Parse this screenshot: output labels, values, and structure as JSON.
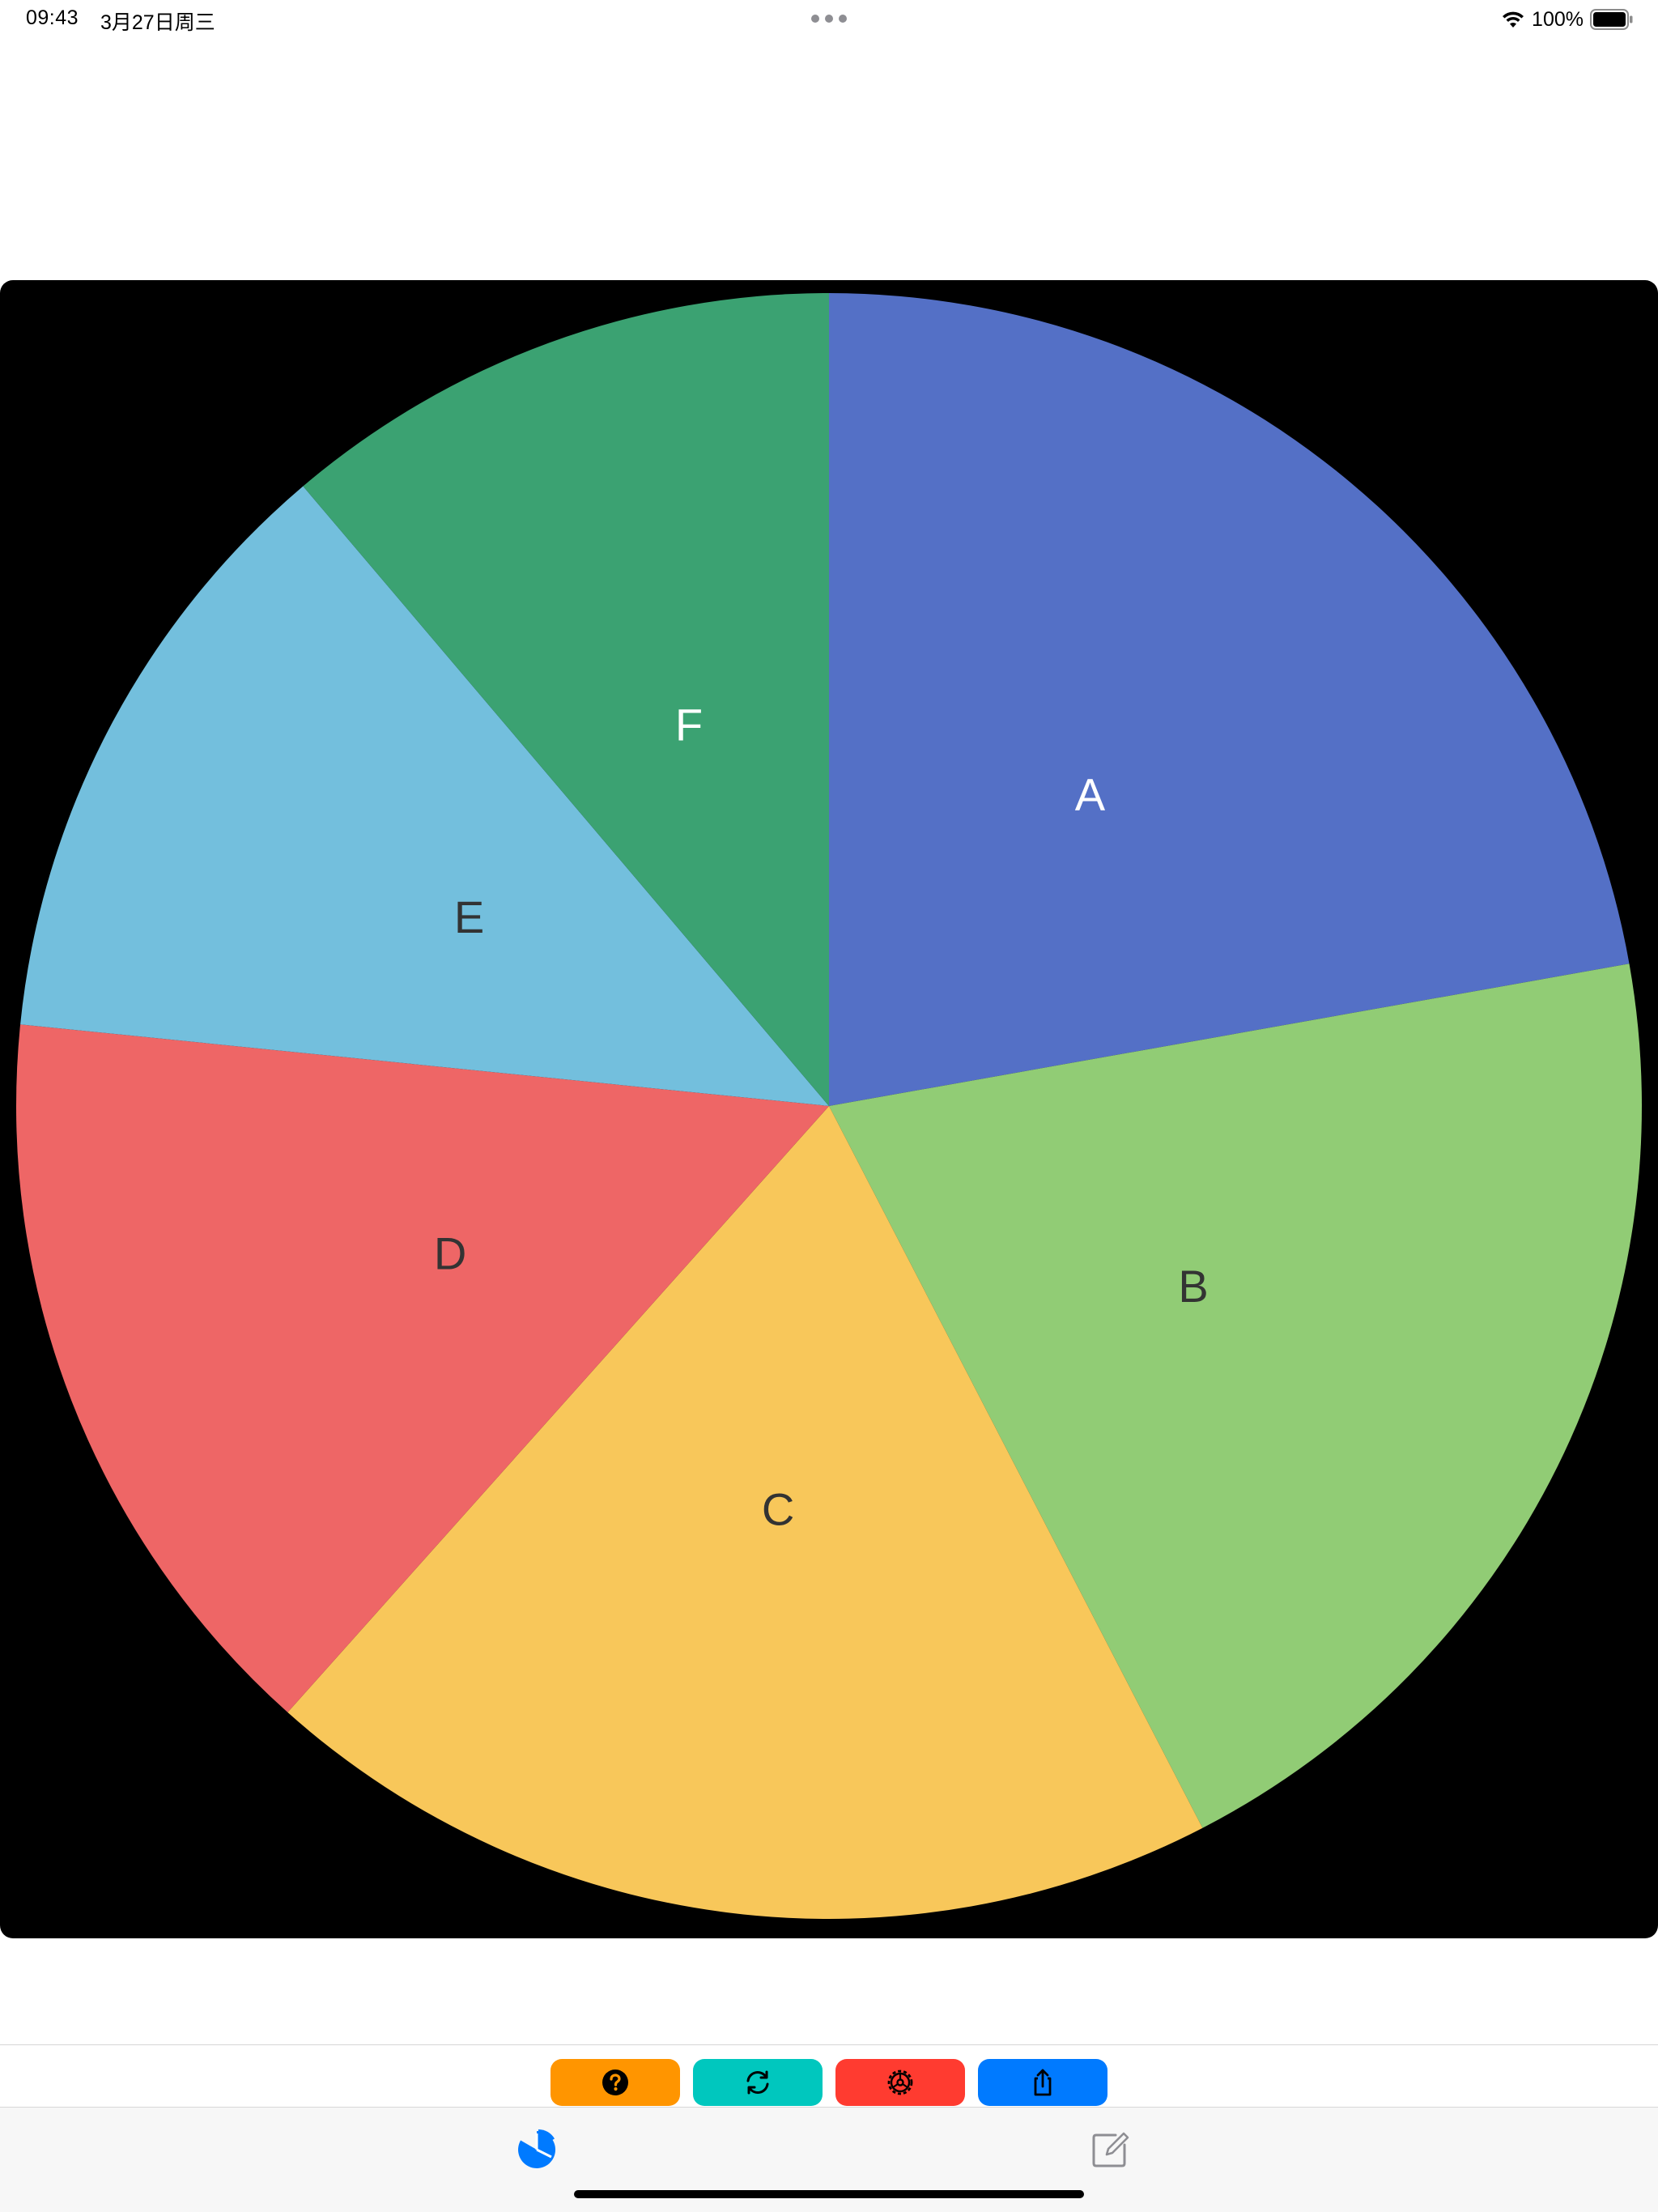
{
  "status_bar": {
    "time": "09:43",
    "date": "3月27日周三",
    "battery": "100%"
  },
  "colors": {
    "help": "#FF9500",
    "refresh": "#00C7BE",
    "settings": "#FF3B30",
    "share": "#007AFF",
    "tab_active": "#007AFF",
    "tab_inactive": "#8E8E93"
  },
  "chart_data": {
    "type": "pie",
    "start_angle": "12 o'clock, clockwise",
    "slices": [
      {
        "label": "A",
        "value": 22.2,
        "color": "#5470C6",
        "label_color": "#ffffff"
      },
      {
        "label": "B",
        "value": 20.2,
        "color": "#91CC75",
        "label_color": "#333333"
      },
      {
        "label": "C",
        "value": 19.2,
        "color": "#F8C75A",
        "label_color": "#333333"
      },
      {
        "label": "D",
        "value": 15.0,
        "color": "#EE6666",
        "label_color": "#333333"
      },
      {
        "label": "E",
        "value": 12.2,
        "color": "#73BFDD",
        "label_color": "#333333"
      },
      {
        "label": "F",
        "value": 11.2,
        "color": "#3BA272",
        "label_color": "#ffffff"
      }
    ]
  },
  "toolbar": {
    "buttons": [
      {
        "name": "help-button",
        "icon": "question-circle-icon"
      },
      {
        "name": "refresh-button",
        "icon": "refresh-icon"
      },
      {
        "name": "settings-button",
        "icon": "gear-icon"
      },
      {
        "name": "share-button",
        "icon": "share-icon"
      }
    ]
  },
  "tab_bar": {
    "tabs": [
      {
        "name": "tab-chart",
        "icon": "pie-chart-icon",
        "active": true
      },
      {
        "name": "tab-edit",
        "icon": "edit-icon",
        "active": false
      }
    ]
  }
}
